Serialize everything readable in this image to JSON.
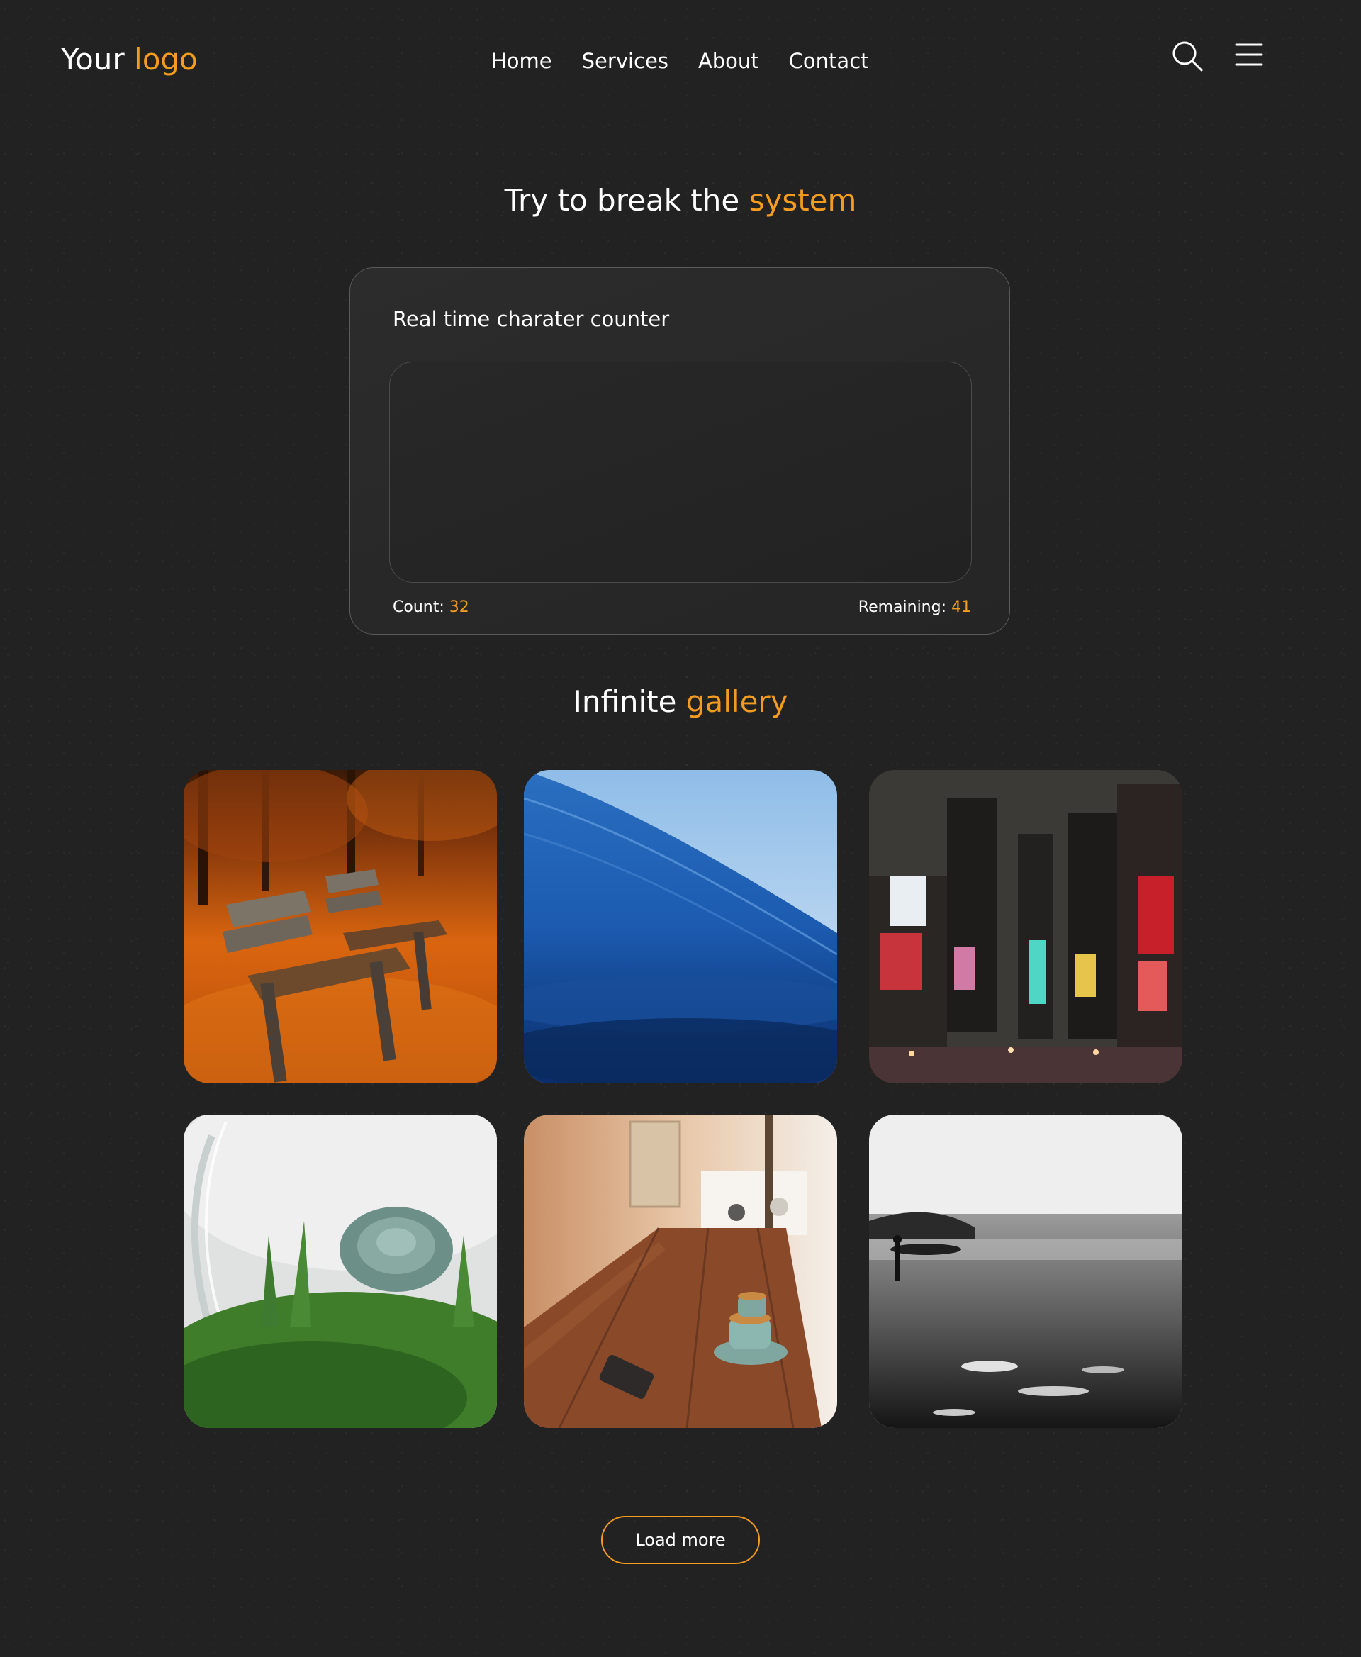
{
  "brand": {
    "logo_main": "Your",
    "logo_accent": "logo",
    "accent_color": "#f39c1f",
    "background_color": "#222222"
  },
  "nav": {
    "links": [
      "Home",
      "Services",
      "About",
      "Contact"
    ],
    "icons": [
      "search-icon",
      "hamburger-menu-icon"
    ]
  },
  "counter": {
    "title_main": "Try to break the",
    "title_accent": "system",
    "label": "Real time charater counter",
    "textarea_value": "",
    "count_label": "Count:",
    "count_value": "32",
    "remaining_label": "Remaining:",
    "remaining_value": "41"
  },
  "gallery": {
    "title_main": "Infinite",
    "title_accent": "gallery",
    "images": [
      "autumn-park-bench-photo",
      "ocean-wave-photo",
      "city-night-billboards-photo",
      "succulent-terrarium-photo",
      "cafe-table-coffee-cups-photo",
      "black-white-surfer-beach-photo"
    ],
    "load_more_label": "Load more"
  }
}
